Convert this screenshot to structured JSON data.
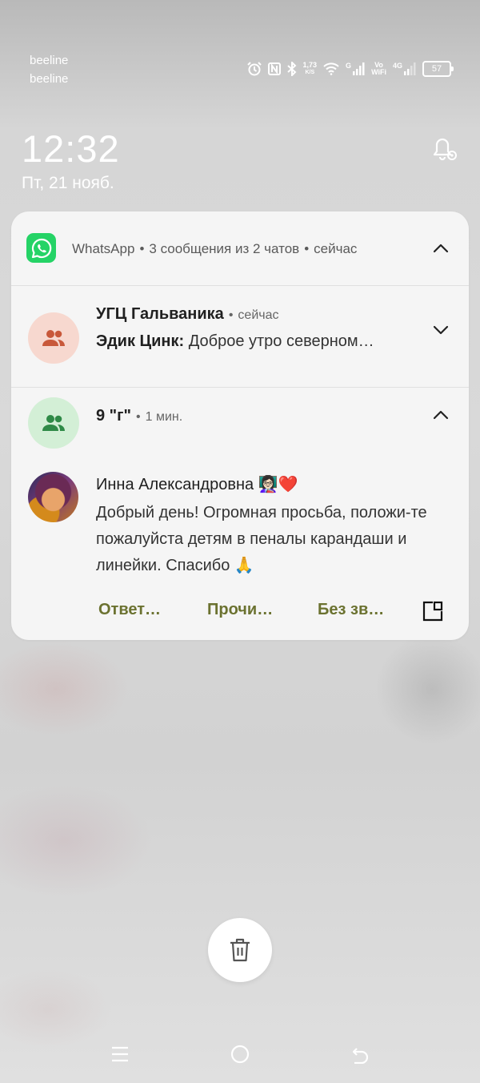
{
  "status_bar": {
    "carrier_1": "beeline",
    "carrier_2": "beeline",
    "speed_value": "1,73",
    "speed_unit": "K/S",
    "net_g": "G",
    "volte_1": "Vo",
    "volte_2": "WiFi",
    "net_4g": "4G",
    "battery": "57"
  },
  "lockscreen": {
    "time": "12:32",
    "date": "Пт, 21 нояб."
  },
  "notification": {
    "app_name": "WhatsApp",
    "summary": "3 сообщения из 2 чатов",
    "time": "сейчас",
    "accent_color": "#25D366",
    "chat1": {
      "title": "УГЦ Гальваника",
      "time": "сейчас",
      "sender": "Эдик Цинк:",
      "message": "Доброе утро северном…"
    },
    "chat2": {
      "title": "9 \"г\"",
      "time": "1 мин.",
      "sender": "Инна Александровна 👩🏻‍🏫❤️",
      "message": "Добрый день! Огромная просьба, положи-те пожалуйста детям в пеналы карандаши и линейки. Спасибо 🙏"
    },
    "actions": {
      "reply": "Ответ…",
      "mark_read": "Прочи…",
      "mute": "Без зв…"
    }
  }
}
